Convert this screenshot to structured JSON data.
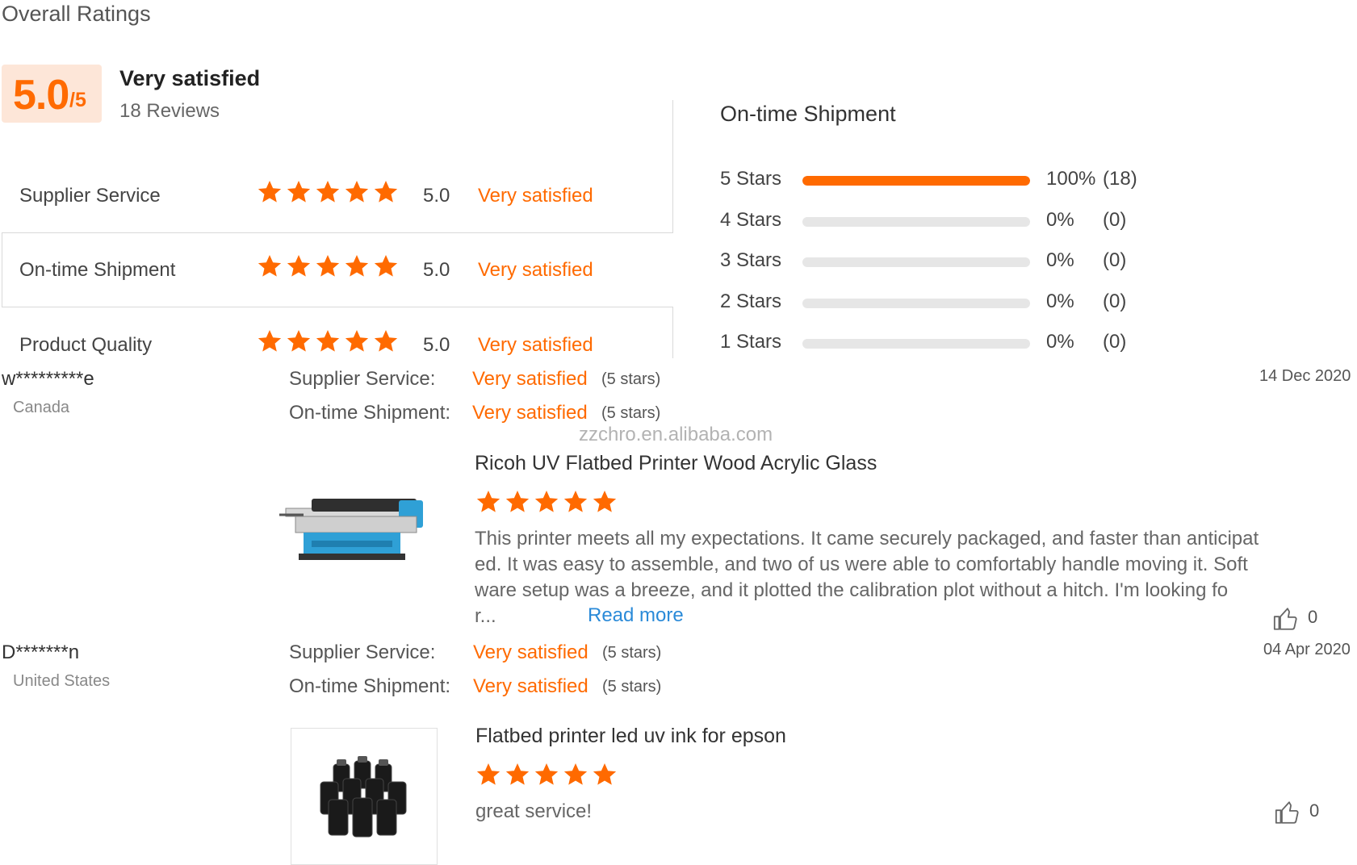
{
  "header": {
    "title": "Overall Ratings",
    "score": "5.0",
    "score_max": "/5",
    "level": "Very satisfied",
    "review_count": "18 Reviews"
  },
  "criteria": [
    {
      "name": "Supplier Service",
      "stars": 5,
      "score": "5.0",
      "level": "Very satisfied"
    },
    {
      "name": "On-time Shipment",
      "stars": 5,
      "score": "5.0",
      "level": "Very satisfied"
    },
    {
      "name": "Product Quality",
      "stars": 5,
      "score": "5.0",
      "level": "Very satisfied"
    }
  ],
  "distribution": {
    "title": "On-time Shipment",
    "rows": [
      {
        "label": "5  Stars",
        "fraction": 1.0,
        "percent": "100%",
        "count": "(18)"
      },
      {
        "label": "4  Stars",
        "fraction": 0.0,
        "percent": "0%",
        "count": "(0)"
      },
      {
        "label": "3  Stars",
        "fraction": 0.0,
        "percent": "0%",
        "count": "(0)"
      },
      {
        "label": "2  Stars",
        "fraction": 0.0,
        "percent": "0%",
        "count": "(0)"
      },
      {
        "label": "1  Stars",
        "fraction": 0.0,
        "percent": "0%",
        "count": "(0)"
      }
    ]
  },
  "watermark": "zzchro.en.alibaba.com",
  "reviews": [
    {
      "name": "w*********e",
      "country": "Canada",
      "date": "14 Dec 2020",
      "ratings": [
        {
          "label": "Supplier Service:",
          "level": "Very satisfied",
          "stars": "(5 stars)"
        },
        {
          "label": "On-time Shipment:",
          "level": "Very satisfied",
          "stars": "(5 stars)"
        }
      ],
      "product_title": "Ricoh UV Flatbed Printer Wood Acrylic Glass",
      "product_stars": 5,
      "text_lines": [
        "This printer meets all my expectations. It came securely packaged, and faster than anticipat",
        "ed. It was easy to assemble, and two of us were able to comfortably handle moving it. Soft",
        "ware setup was a breeze, and it plotted the calibration plot without a hitch.  I'm looking fo",
        "r..."
      ],
      "read_more": "Read more",
      "likes": "0"
    },
    {
      "name": "D*******n",
      "country": "United States",
      "date": "04 Apr 2020",
      "ratings": [
        {
          "label": "Supplier Service:",
          "level": "Very satisfied",
          "stars": "(5 stars)"
        },
        {
          "label": "On-time Shipment:",
          "level": "Very satisfied",
          "stars": "(5 stars)"
        }
      ],
      "product_title": "Flatbed printer led uv ink for epson",
      "product_stars": 5,
      "text": "great service!",
      "likes": "0"
    }
  ],
  "colors": {
    "accent": "#ff6a00",
    "score_bg": "#fde6d8",
    "link": "#2a8ad8",
    "bar_track": "#e6e6e6"
  },
  "icons": [
    "star-icon",
    "thumbs-up-icon"
  ]
}
